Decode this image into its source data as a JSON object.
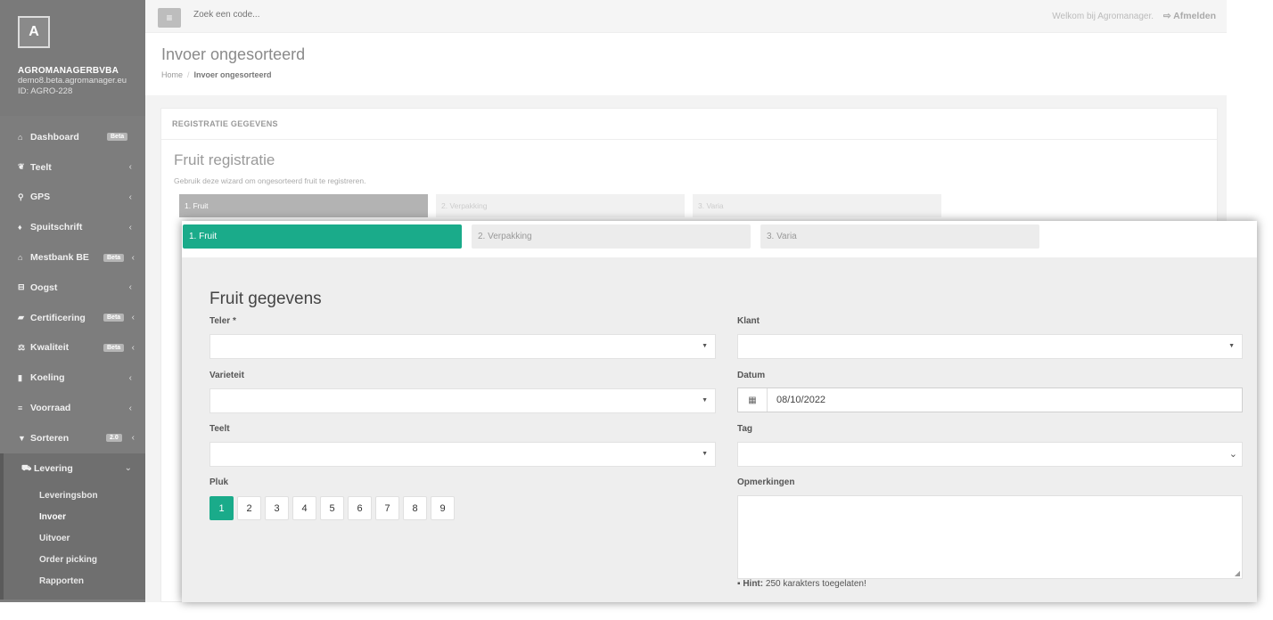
{
  "sidebar": {
    "avatar_letter": "A",
    "company": "AGROMANAGERBVBA",
    "email": "demo8.beta.agromanager.eu",
    "id": "ID: AGRO-228",
    "items": [
      {
        "icon": "home-icon",
        "glyph": "⌂",
        "label": "Dashboard",
        "badge": "Beta"
      },
      {
        "icon": "leaf-icon",
        "glyph": "❦",
        "label": "Teelt"
      },
      {
        "icon": "map-marker-icon",
        "glyph": "⚲",
        "label": "GPS"
      },
      {
        "icon": "drop-icon",
        "glyph": "♦",
        "label": "Spuitschrift"
      },
      {
        "icon": "bank-icon",
        "glyph": "⌂",
        "label": "Mestbank BE",
        "badge": "Beta"
      },
      {
        "icon": "basket-icon",
        "glyph": "⊟",
        "label": "Oogst"
      },
      {
        "icon": "book-icon",
        "glyph": "▰",
        "label": "Certificering",
        "badge": "Beta"
      },
      {
        "icon": "scale-icon",
        "glyph": "⚖",
        "label": "Kwaliteit",
        "badge": "Beta"
      },
      {
        "icon": "thermometer-icon",
        "glyph": "▮",
        "label": "Koeling"
      },
      {
        "icon": "list-icon",
        "glyph": "≡",
        "label": "Voorraad"
      },
      {
        "icon": "filter-icon",
        "glyph": "▼",
        "label": "Sorteren",
        "badge": "2.0"
      },
      {
        "icon": "truck-icon",
        "glyph": "⛟",
        "label": "Levering"
      }
    ],
    "subitems": [
      "Leveringsbon",
      "Invoer",
      "Uitvoer",
      "Order picking",
      "Rapporten"
    ]
  },
  "topbar": {
    "search_placeholder": "Zoek een code...",
    "welcome": "Welkom bij Agromanager.",
    "logout": "Afmelden"
  },
  "header": {
    "title": "Invoer ongesorteerd",
    "crumb_home": "Home",
    "crumb_current": "Invoer ongesorteerd"
  },
  "panel": {
    "heading": "REGISTRATIE GEGEVENS",
    "title": "Fruit registratie",
    "subtitle": "Gebruik deze wizard om ongesorteerd fruit te registreren."
  },
  "steps": [
    "1. Fruit",
    "2. Verpakking",
    "3. Varia"
  ],
  "form": {
    "title": "Fruit gegevens",
    "teler_label": "Teler *",
    "klant_label": "Klant",
    "varieteit_label": "Varieteit",
    "datum_label": "Datum",
    "datum_value": "08/10/2022",
    "teelt_label": "Teelt",
    "tag_label": "Tag",
    "pluk_label": "Pluk",
    "opmerkingen_label": "Opmerkingen",
    "pluk_options": [
      "1",
      "2",
      "3",
      "4",
      "5",
      "6",
      "7",
      "8",
      "9"
    ],
    "pluk_selected": "1",
    "hint_label": "Hint:",
    "hint_text": " 250 karakters toegelaten!"
  },
  "colors": {
    "accent": "#1aab8a",
    "sidebar": "#7d7d7d"
  }
}
